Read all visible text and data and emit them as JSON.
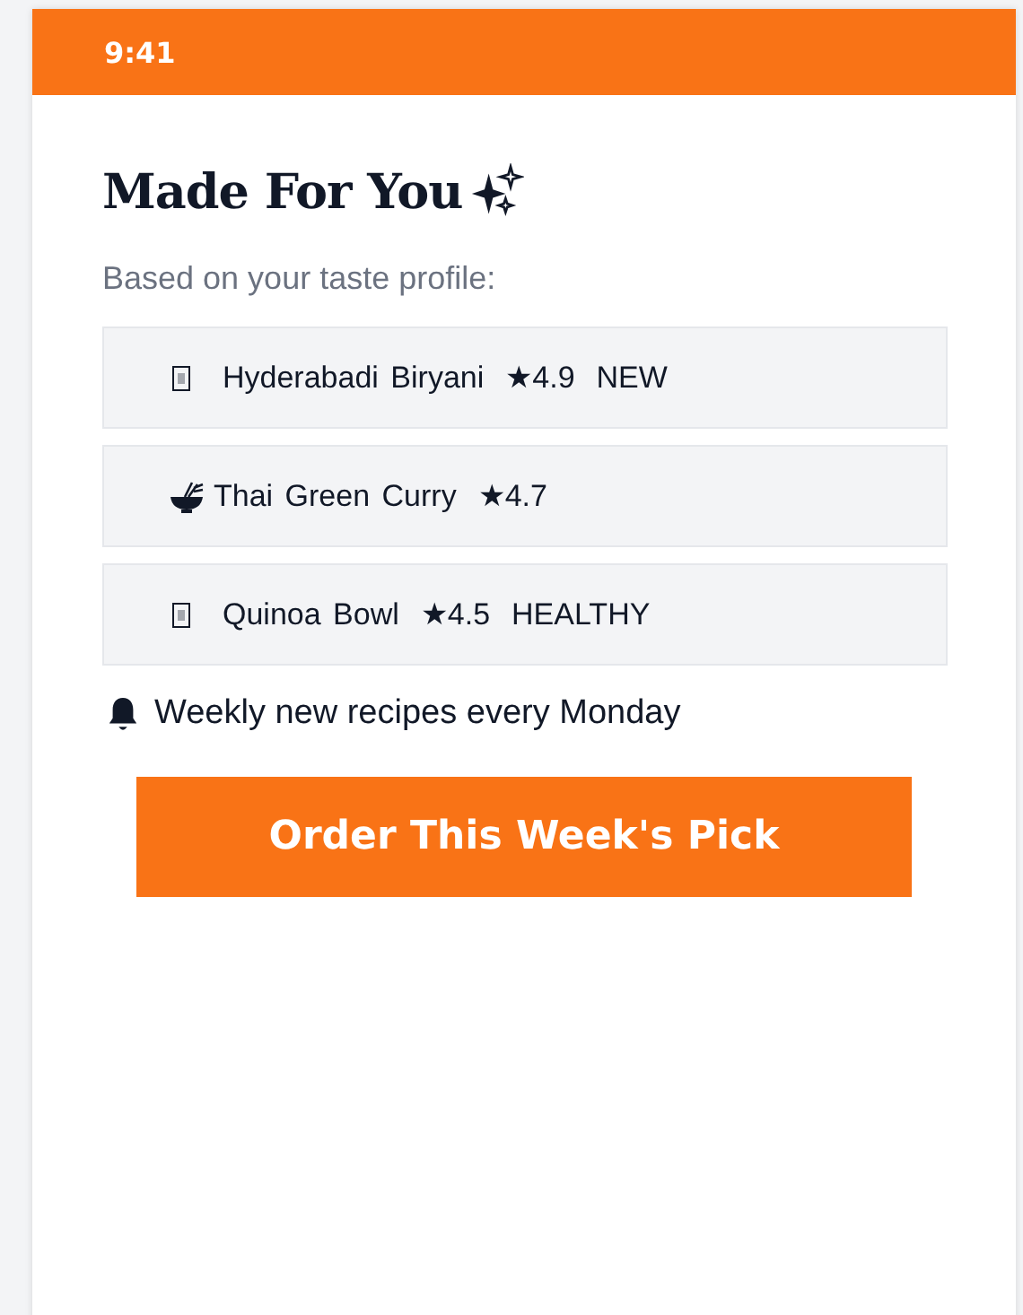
{
  "status_bar": {
    "time": "9:41"
  },
  "title": "Made For You",
  "subtitle": "Based on your taste profile:",
  "recipes": [
    {
      "kind": "missing",
      "name": "Hyderabadi Biryani",
      "rating": "★4.9",
      "tag": "NEW"
    },
    {
      "kind": "bowl",
      "name": "Thai Green Curry",
      "rating": "★4.7"
    },
    {
      "kind": "missing",
      "name": "Quinoa Bowl",
      "rating": "★4.5",
      "tag": "HEALTHY"
    }
  ],
  "notice": "Weekly new recipes every Monday",
  "cta_button": "Order This Week's Pick"
}
